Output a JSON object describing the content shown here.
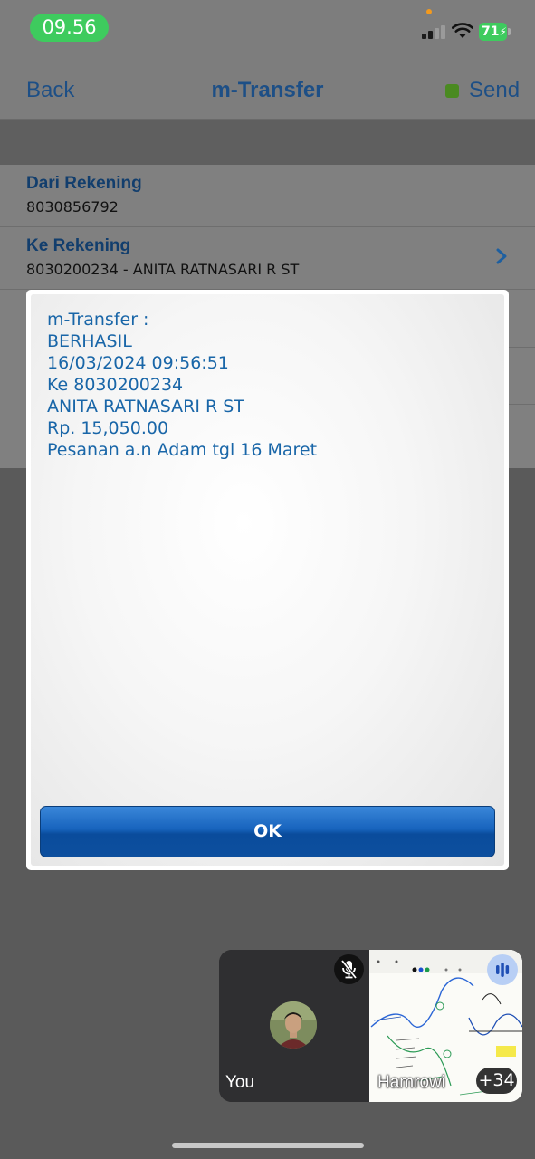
{
  "status_bar": {
    "time": "09.56",
    "battery": "71"
  },
  "nav": {
    "back": "Back",
    "title": "m-Transfer",
    "send": "Send"
  },
  "form": {
    "from_label": "Dari Rekening",
    "from_value": "8030856792",
    "to_label": "Ke Rekening",
    "to_value": "8030200234 - ANITA RATNASARI R ST"
  },
  "dialog": {
    "lines": [
      "m-Transfer :",
      "BERHASIL",
      "16/03/2024 09:56:51",
      "Ke 8030200234",
      "ANITA RATNASARI R ST",
      "Rp. 15,050.00",
      "Pesanan a.n Adam tgl 16 Maret"
    ],
    "ok": "OK"
  },
  "call": {
    "self_label": "You",
    "other_label": "Hamrowi",
    "more_count": "+34"
  },
  "colors": {
    "accent": "#1d4f86",
    "message": "#1966a8",
    "ok_button": "#1763bd",
    "status_green": "#3ecb5e"
  }
}
